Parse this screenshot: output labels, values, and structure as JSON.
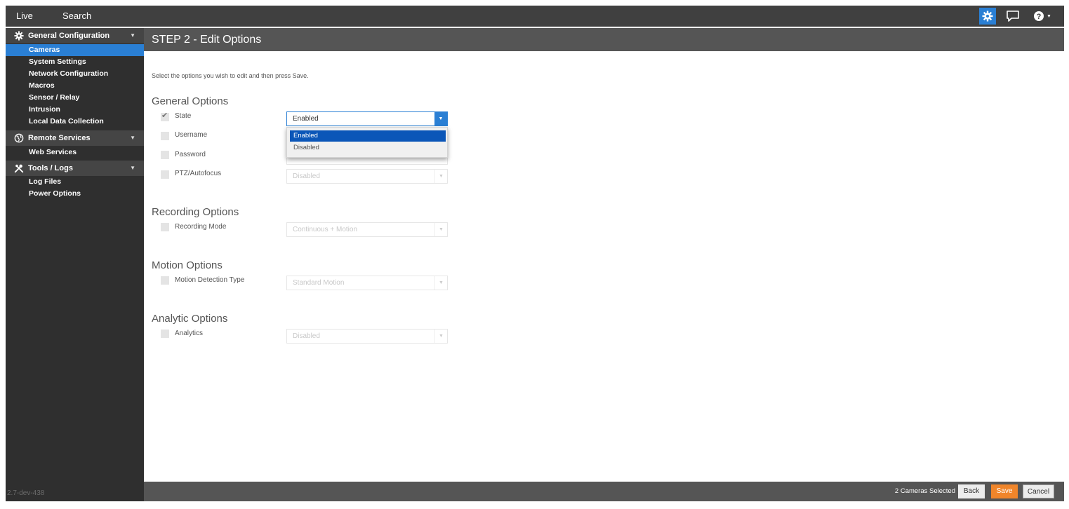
{
  "topbar": {
    "nav": [
      {
        "label": "Live"
      },
      {
        "label": "Search"
      }
    ],
    "icons": {
      "settings": "gear-icon",
      "messages": "chat-icon",
      "help": "help-icon"
    },
    "accent": "#2a7fd4"
  },
  "sidebar": {
    "groups": [
      {
        "label": "General Configuration",
        "icon": "gear-icon",
        "items": [
          "Cameras",
          "System Settings",
          "Network Configuration",
          "Macros",
          "Sensor / Relay",
          "Intrusion",
          "Local Data Collection"
        ]
      },
      {
        "label": "Remote Services",
        "icon": "globe-icon",
        "items": [
          "Web Services"
        ]
      },
      {
        "label": "Tools / Logs",
        "icon": "tools-icon",
        "items": [
          "Log Files",
          "Power Options"
        ]
      }
    ],
    "active_item": "Cameras",
    "version": "2.7-dev-438"
  },
  "main": {
    "title": "STEP 2 - Edit Options",
    "instructions": "Select the options you wish to edit and then press Save.",
    "sections": {
      "general": {
        "title": "General Options",
        "state": {
          "label": "State",
          "checked": true,
          "value": "Enabled"
        },
        "username": {
          "label": "Username",
          "checked": false
        },
        "password": {
          "label": "Password",
          "checked": false
        },
        "ptz": {
          "label": "PTZ/Autofocus",
          "checked": false,
          "value": "Disabled"
        }
      },
      "recording": {
        "title": "Recording Options",
        "mode": {
          "label": "Recording Mode",
          "checked": false,
          "value": "Continuous + Motion"
        }
      },
      "motion": {
        "title": "Motion Options",
        "detection": {
          "label": "Motion Detection Type",
          "checked": false,
          "value": "Standard Motion"
        }
      },
      "analytic": {
        "title": "Analytic Options",
        "analytics": {
          "label": "Analytics",
          "checked": false,
          "value": "Disabled"
        }
      }
    },
    "state_dropdown": {
      "options": [
        "Enabled",
        "Disabled"
      ],
      "selected": "Enabled"
    }
  },
  "footer": {
    "status": "2 Cameras Selected",
    "back_label": "Back",
    "save_label": "Save",
    "cancel_label": "Cancel",
    "save_color": "#f0852a"
  }
}
